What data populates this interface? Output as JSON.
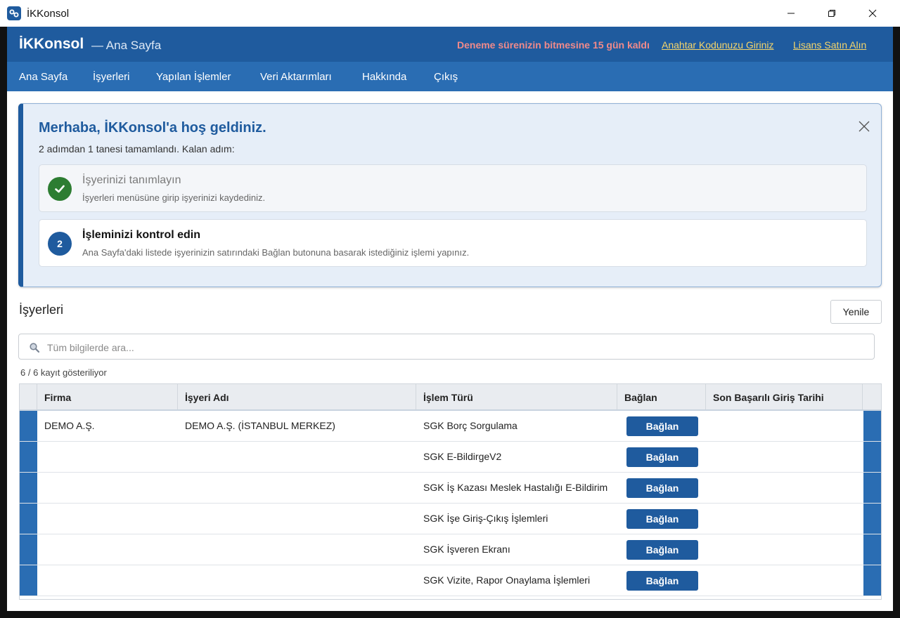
{
  "window": {
    "title": "İKKonsol",
    "minimize_icon": "minimize-icon",
    "maximize_icon": "restore-icon",
    "close_icon": "close-icon"
  },
  "header": {
    "brand": "İKKonsol",
    "subtitle": "— Ana Sayfa",
    "trial_text": "Deneme sürenizin bitmesine 15 gün kaldı",
    "key_link": "Anahtar Kodunuzu Giriniz",
    "buy_link": "Lisans Satın Alın",
    "trial_color": "#f08a8a",
    "link_color": "#f5d56a",
    "bg_color": "#1f5b9e"
  },
  "nav": {
    "items": [
      {
        "label": "Ana Sayfa"
      },
      {
        "label": "İşyerleri"
      },
      {
        "label": "Yapılan İşlemler"
      },
      {
        "label": "Veri Aktarımları"
      },
      {
        "label": "Hakkında"
      },
      {
        "label": "Çıkış"
      }
    ]
  },
  "welcome": {
    "title": "Merhaba, İKKonsol'a hoş geldiniz.",
    "progress": "2 adımdan 1 tanesi tamamlandı. Kalan adım:",
    "steps": [
      {
        "title": "İşyerinizi tanımlayın",
        "description": "İşyerleri menüsüne girip işyerinizi kaydediniz.",
        "status": "done",
        "icon": "check-icon"
      },
      {
        "number": "2",
        "title": "İşleminizi kontrol edin",
        "description": "Ana Sayfa'daki listede işyerinizin satırındaki Bağlan butonuna basarak istediğiniz işlemi yapınız.",
        "status": "pending"
      }
    ]
  },
  "workplaces": {
    "title": "İşyerleri",
    "refresh_label": "Yenile",
    "search_placeholder": "Tüm bilgilerde ara...",
    "record_count": "6 / 6 kayıt gösteriliyor",
    "columns": [
      "Firma",
      "İşyeri Adı",
      "İşlem Türü",
      "Bağlan",
      "Son Başarılı Giriş Tarihi"
    ],
    "rows": [
      {
        "firma": "DEMO A.Ş.",
        "isyeri": "DEMO A.Ş. (İSTANBUL MERKEZ)",
        "islem": "SGK Borç Sorgulama",
        "button": "Bağlan",
        "tarih": ""
      },
      {
        "firma": "",
        "isyeri": "",
        "islem": "SGK E-BildirgeV2",
        "button": "Bağlan",
        "tarih": ""
      },
      {
        "firma": "",
        "isyeri": "",
        "islem": "SGK İş Kazası Meslek Hastalığı E-Bildirim",
        "button": "Bağlan",
        "tarih": ""
      },
      {
        "firma": "",
        "isyeri": "",
        "islem": "SGK İşe Giriş-Çıkış İşlemleri",
        "button": "Bağlan",
        "tarih": ""
      },
      {
        "firma": "",
        "isyeri": "",
        "islem": "SGK İşveren Ekranı",
        "button": "Bağlan",
        "tarih": ""
      },
      {
        "firma": "",
        "isyeri": "",
        "islem": "SGK Vizite, Rapor Onaylama İşlemleri",
        "button": "Bağlan",
        "tarih": ""
      }
    ]
  }
}
